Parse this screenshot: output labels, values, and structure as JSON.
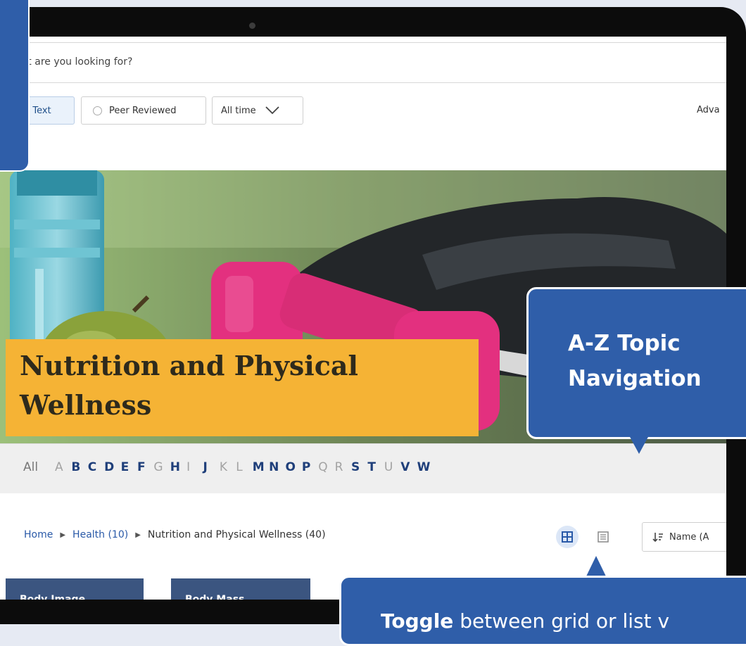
{
  "search": {
    "placeholder": "What are you looking for?"
  },
  "filters": {
    "full_text_label": "ll Text",
    "peer_reviewed_label": "Peer Reviewed",
    "time_label": "All time",
    "advanced_label": "Adva"
  },
  "hero": {
    "title": "Nutrition and Physical Wellness"
  },
  "az_nav": {
    "all_label": "All",
    "letters": [
      {
        "letter": "A",
        "enabled": false
      },
      {
        "letter": "B",
        "enabled": true
      },
      {
        "letter": "C",
        "enabled": true
      },
      {
        "letter": "D",
        "enabled": true
      },
      {
        "letter": "E",
        "enabled": true
      },
      {
        "letter": "F",
        "enabled": true
      },
      {
        "letter": "G",
        "enabled": false
      },
      {
        "letter": "H",
        "enabled": true
      },
      {
        "letter": "I",
        "enabled": false
      },
      {
        "letter": "J",
        "enabled": true
      },
      {
        "letter": "K",
        "enabled": false
      },
      {
        "letter": "L",
        "enabled": false
      },
      {
        "letter": "M",
        "enabled": true
      },
      {
        "letter": "N",
        "enabled": true
      },
      {
        "letter": "O",
        "enabled": true
      },
      {
        "letter": "P",
        "enabled": true
      },
      {
        "letter": "Q",
        "enabled": false
      },
      {
        "letter": "R",
        "enabled": false
      },
      {
        "letter": "S",
        "enabled": true
      },
      {
        "letter": "T",
        "enabled": true
      },
      {
        "letter": "U",
        "enabled": false
      },
      {
        "letter": "V",
        "enabled": true
      },
      {
        "letter": "W",
        "enabled": true
      }
    ]
  },
  "breadcrumb": {
    "home": "Home",
    "health": "Health (10)",
    "current": "Nutrition and Physical Wellness (40)"
  },
  "view_toggle": {
    "grid_icon": "grid-view-icon",
    "list_icon": "list-view-icon",
    "active": "grid"
  },
  "sort": {
    "label": "Name (A"
  },
  "cards": [
    {
      "title": "Body Image"
    },
    {
      "title": "Body Mass"
    }
  ],
  "callouts": {
    "az_title": "A-Z Topic Navigation",
    "toggle_bold": "Toggle",
    "toggle_rest": "between grid or list v"
  },
  "colors": {
    "accent_blue": "#2f5ea9",
    "link_blue": "#1f3f7a",
    "hero_banner": "#f5b335",
    "card_bg": "#3b5580"
  }
}
